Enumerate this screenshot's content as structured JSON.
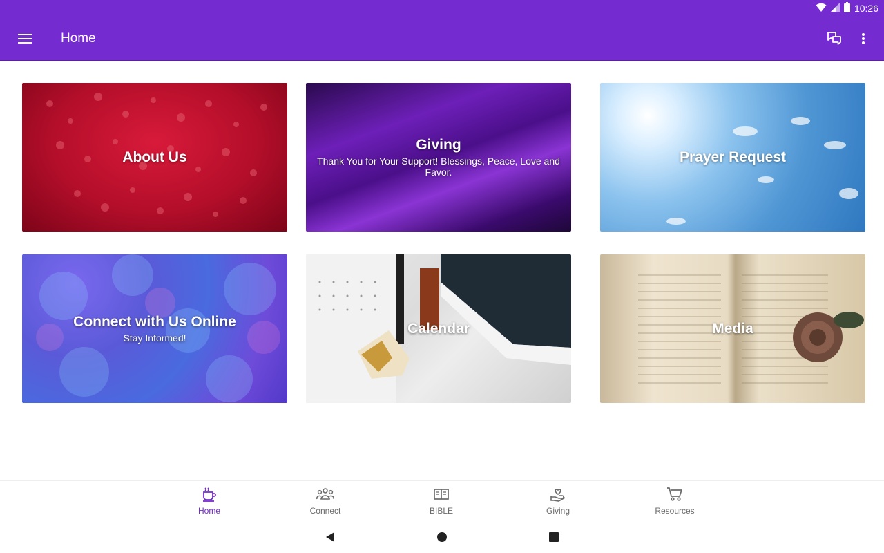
{
  "status_bar": {
    "time": "10:26"
  },
  "app_bar": {
    "title": "Home",
    "color": "#742bd0"
  },
  "tiles": [
    {
      "title": "About Us",
      "subtitle": ""
    },
    {
      "title": "Giving",
      "subtitle": "Thank You for Your Support!  Blessings, Peace, Love and Favor."
    },
    {
      "title": "Prayer Request",
      "subtitle": ""
    },
    {
      "title": "Connect with Us Online",
      "subtitle": "Stay Informed!"
    },
    {
      "title": "Calendar",
      "subtitle": ""
    },
    {
      "title": "Media",
      "subtitle": ""
    }
  ],
  "bottom_nav": {
    "active": "Home",
    "items": [
      {
        "label": "Home",
        "icon": "coffee-cup-icon"
      },
      {
        "label": "Connect",
        "icon": "people-icon"
      },
      {
        "label": "BIBLE",
        "icon": "book-icon"
      },
      {
        "label": "Giving",
        "icon": "giving-hand-icon"
      },
      {
        "label": "Resources",
        "icon": "cart-icon"
      }
    ]
  }
}
